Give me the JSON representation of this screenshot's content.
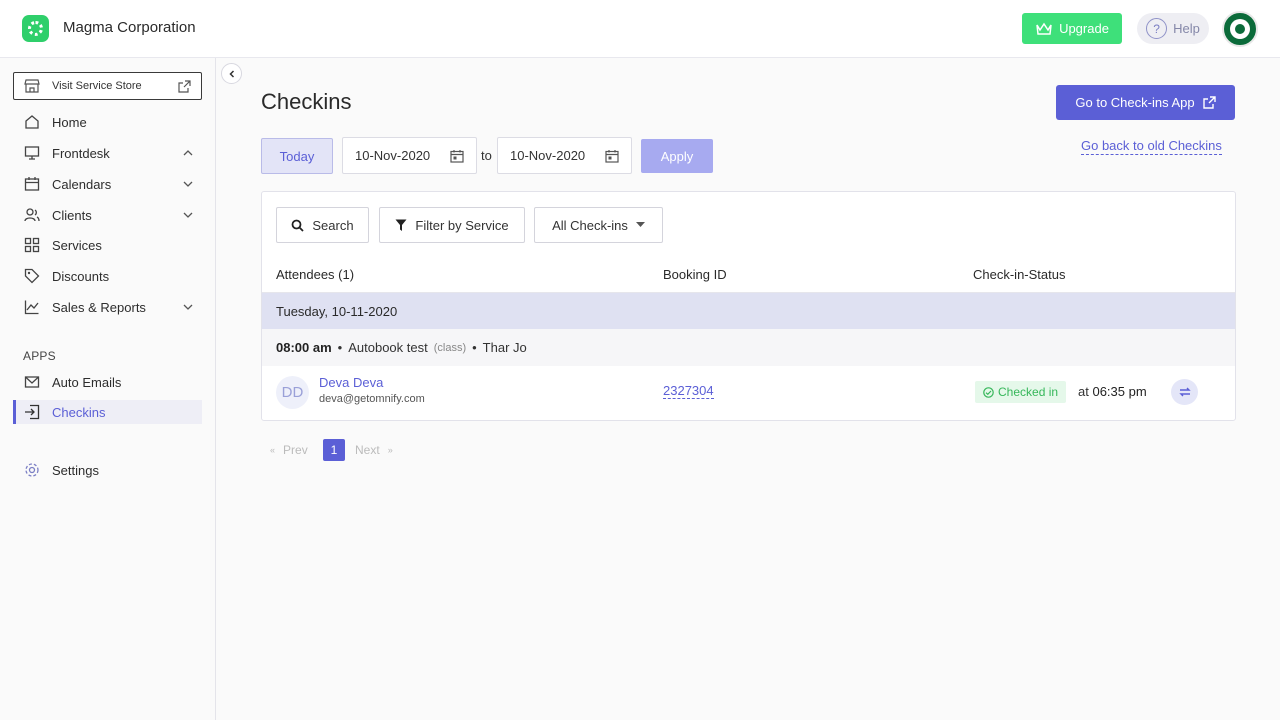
{
  "header": {
    "company": "Magma Corporation",
    "upgrade_label": "Upgrade",
    "help_label": "Help"
  },
  "sidebar": {
    "store_label": "Visit Service Store",
    "items": [
      {
        "label": "Home",
        "icon": "home-icon"
      },
      {
        "label": "Frontdesk",
        "icon": "monitor-icon",
        "expanded": true
      },
      {
        "label": "Calendars",
        "icon": "calendar-icon"
      },
      {
        "label": "Clients",
        "icon": "users-icon"
      },
      {
        "label": "Services",
        "icon": "grid-icon"
      },
      {
        "label": "Discounts",
        "icon": "tag-icon"
      },
      {
        "label": "Sales & Reports",
        "icon": "chart-icon"
      }
    ],
    "apps_heading": "APPS",
    "apps": [
      {
        "label": "Auto Emails",
        "icon": "mail-icon"
      },
      {
        "label": "Checkins",
        "icon": "checkin-icon",
        "active": true
      }
    ],
    "settings_label": "Settings"
  },
  "main": {
    "title": "Checkins",
    "go_app_label": "Go to Check-ins App",
    "go_back_label": "Go back to old Checkins",
    "today_label": "Today",
    "from_date": "10-Nov-2020",
    "to_label": "to",
    "to_date": "10-Nov-2020",
    "apply_label": "Apply",
    "toolbar": {
      "search_label": "Search",
      "filter_label": "Filter by Service",
      "dropdown_value": "All Check-ins"
    },
    "columns": [
      "Attendees (1)",
      "Booking ID",
      "Check-in-Status"
    ],
    "date_group": "Tuesday, 10-11-2020",
    "session": {
      "time": "08:00 am",
      "name": "Autobook test",
      "kind": "(class)",
      "staff": "Thar Jo"
    },
    "attendee": {
      "initials": "DD",
      "name": "Deva Deva",
      "email": "deva@getomnify.com",
      "booking_id": "2327304",
      "status": "Checked in",
      "status_prefix": "at",
      "status_time": "06:35 pm"
    },
    "pagination": {
      "prev": "Prev",
      "current": "1",
      "next": "Next"
    }
  },
  "colors": {
    "accent": "#5b5fd6",
    "success": "#3ee07a",
    "checked_in": "#36b75a"
  }
}
